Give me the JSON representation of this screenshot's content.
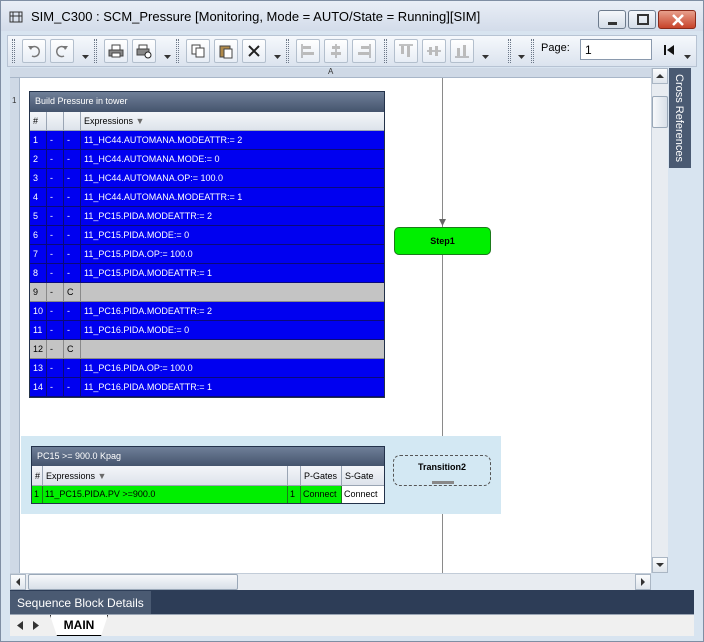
{
  "window": {
    "title": "SIM_C300 : SCM_Pressure [Monitoring, Mode  = AUTO/State = Running][SIM]"
  },
  "toolbar": {
    "page_label": "Page:",
    "page_value": "1",
    "buttons": [
      "undo-icon",
      "redo-icon",
      "print-icon",
      "print-preview-icon",
      "copy-icon",
      "paste-icon",
      "delete-icon",
      "align-left-icon",
      "align-center-icon",
      "align-right-icon",
      "align-top-icon",
      "align-middle-icon",
      "align-bottom-icon",
      "first-page-icon"
    ]
  },
  "canvas": {
    "ruler_col": "A",
    "ruler_row": "1"
  },
  "step_table": {
    "title": "Build Pressure in tower",
    "headers": {
      "num": "#",
      "expr": "Expressions"
    },
    "rows": [
      {
        "num": "1",
        "a": "-",
        "b": "-",
        "expr": "11_HC44.AUTOMANA.MODEATTR:= 2",
        "style": "blue"
      },
      {
        "num": "2",
        "a": "-",
        "b": "-",
        "expr": "11_HC44.AUTOMANA.MODE:= 0",
        "style": "blue"
      },
      {
        "num": "3",
        "a": "-",
        "b": "-",
        "expr": "11_HC44.AUTOMANA.OP:= 100.0",
        "style": "blue"
      },
      {
        "num": "4",
        "a": "-",
        "b": "-",
        "expr": "11_HC44.AUTOMANA.MODEATTR:= 1",
        "style": "blue"
      },
      {
        "num": "5",
        "a": "-",
        "b": "-",
        "expr": "11_PC15.PIDA.MODEATTR:= 2",
        "style": "blue"
      },
      {
        "num": "6",
        "a": "-",
        "b": "-",
        "expr": "11_PC15.PIDA.MODE:= 0",
        "style": "blue"
      },
      {
        "num": "7",
        "a": "-",
        "b": "-",
        "expr": "11_PC15.PIDA.OP:= 100.0",
        "style": "blue"
      },
      {
        "num": "8",
        "a": "-",
        "b": "-",
        "expr": "11_PC15.PIDA.MODEATTR:= 1",
        "style": "blue"
      },
      {
        "num": "9",
        "a": "-",
        "b": "C",
        "expr": "",
        "style": "gray"
      },
      {
        "num": "10",
        "a": "-",
        "b": "-",
        "expr": "11_PC16.PIDA.MODEATTR:= 2",
        "style": "blue"
      },
      {
        "num": "11",
        "a": "-",
        "b": "-",
        "expr": "11_PC16.PIDA.MODE:= 0",
        "style": "blue"
      },
      {
        "num": "12",
        "a": "-",
        "b": "C",
        "expr": "",
        "style": "gray"
      },
      {
        "num": "13",
        "a": "-",
        "b": "-",
        "expr": "11_PC16.PIDA.OP:= 100.0",
        "style": "blue"
      },
      {
        "num": "14",
        "a": "-",
        "b": "-",
        "expr": "11_PC16.PIDA.MODEATTR:= 1",
        "style": "blue"
      }
    ]
  },
  "step1": {
    "label": "Step1"
  },
  "transition_table": {
    "title": "PC15 >= 900.0 Kpag",
    "headers": {
      "num": "#",
      "expr": "Expressions",
      "pgates": "P-Gates",
      "sgate": "S-Gate"
    },
    "row": {
      "num": "1",
      "expr": "11_PC15.PIDA.PV >=900.0",
      "col3": "1",
      "pgates": "Connect",
      "sgate": "Connect"
    }
  },
  "transition2": {
    "label": "Transition2"
  },
  "side_panel": {
    "label": "Cross References"
  },
  "details": {
    "label": "Sequence Block Details"
  },
  "sheets": {
    "main_tab": "MAIN"
  },
  "colors": {
    "step_blue": "#0000f0",
    "comment_gray": "#c4c4c4",
    "active_green": "#00ef00",
    "header_dark": "#45546d"
  }
}
